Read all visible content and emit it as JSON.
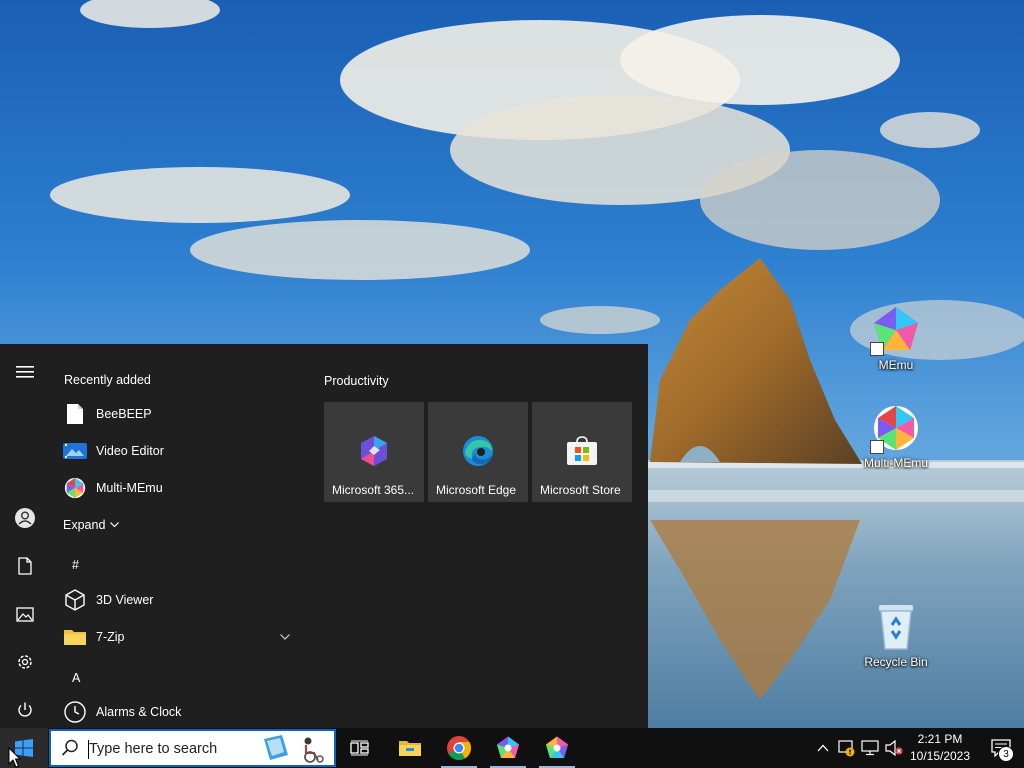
{
  "desktop": {
    "icons": [
      {
        "label": "MEmu",
        "icon": "memu-icon"
      },
      {
        "label": "Multi-MEmu",
        "icon": "multi-memu-icon"
      },
      {
        "label": "Recycle Bin",
        "icon": "recycle-bin-icon"
      }
    ]
  },
  "start_menu": {
    "recently_added_header": "Recently added",
    "recent_apps": [
      {
        "label": "BeeBEEP",
        "icon": "document-icon"
      },
      {
        "label": "Video Editor",
        "icon": "video-editor-icon"
      },
      {
        "label": "Multi-MEmu",
        "icon": "multi-memu-icon"
      }
    ],
    "expand_label": "Expand",
    "letter_hash": "#",
    "letter_a": "A",
    "all_apps": [
      {
        "label": "3D Viewer",
        "icon": "cube-icon"
      },
      {
        "label": "7-Zip",
        "icon": "folder-icon"
      },
      {
        "label": "Alarms & Clock",
        "icon": "clock-icon"
      }
    ],
    "tiles_group": "Productivity",
    "tiles": [
      {
        "label": "Microsoft 365...",
        "icon": "microsoft-365-icon"
      },
      {
        "label": "Microsoft Edge",
        "icon": "edge-icon"
      },
      {
        "label": "Microsoft Store",
        "icon": "store-icon"
      }
    ]
  },
  "taskbar": {
    "search_placeholder": "Type here to search",
    "pinned": [
      "task-view-icon",
      "file-explorer-icon",
      "chrome-icon",
      "memu-icon",
      "multi-memu-icon"
    ],
    "clock_time": "2:21 PM",
    "clock_date": "10/15/2023",
    "notification_count": "3"
  },
  "colors": {
    "start_bg": "#1f1f1f",
    "tile_bg": "#3a3a3a",
    "taskbar_bg": "#101010",
    "accent": "#0a64c8"
  }
}
